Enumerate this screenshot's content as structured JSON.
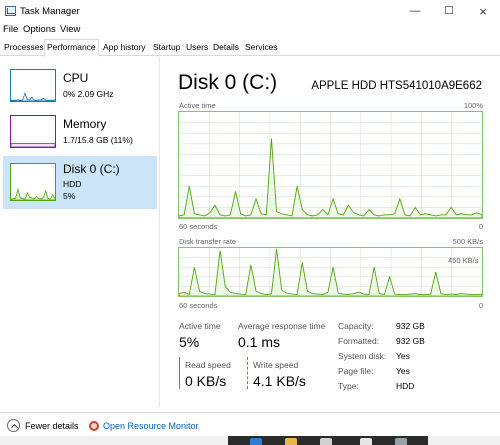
{
  "window": {
    "title": "Task Manager",
    "minimize_icon": "minimize-icon",
    "maximize_icon": "maximize-icon",
    "close_icon": "close-icon"
  },
  "menu": {
    "file": "File",
    "options": "Options",
    "view": "View"
  },
  "tabs": [
    {
      "label": "Processes",
      "active": false
    },
    {
      "label": "Performance",
      "active": true
    },
    {
      "label": "App history",
      "active": false
    },
    {
      "label": "Startup",
      "active": false
    },
    {
      "label": "Users",
      "active": false
    },
    {
      "label": "Details",
      "active": false
    },
    {
      "label": "Services",
      "active": false
    }
  ],
  "sidebar": {
    "items": [
      {
        "name": "CPU",
        "line1": "0%  2.09 GHz",
        "line2": "",
        "color": "#117dbb",
        "selected": false,
        "usage": [
          2,
          3,
          2,
          4,
          2,
          3,
          25,
          5,
          3,
          12,
          3,
          2,
          4,
          3,
          9,
          3,
          2,
          3,
          2,
          4
        ]
      },
      {
        "name": "Memory",
        "line1": "1.7/15.8 GB (11%)",
        "line2": "",
        "color": "#8b12ae",
        "selected": false,
        "usage": [
          11,
          11,
          11,
          11,
          11,
          11,
          11,
          11,
          11,
          11,
          11,
          11,
          11,
          11,
          11,
          11,
          11,
          11,
          11,
          11
        ]
      },
      {
        "name": "Disk 0 (C:)",
        "line1": "HDD",
        "line2": "5%",
        "color": "#4da60c",
        "selected": true,
        "usage": [
          2,
          4,
          5,
          30,
          6,
          4,
          2,
          20,
          8,
          5,
          3,
          10,
          4,
          3,
          6,
          25,
          4,
          3,
          15,
          5
        ]
      }
    ]
  },
  "main": {
    "title": "Disk 0 (C:)",
    "model": "APPLE HDD HTS541010A9E662",
    "active_time": {
      "label": "Active time",
      "max": "100%",
      "xlabel": "60 seconds",
      "xmin": "0",
      "values": [
        2,
        3,
        30,
        4,
        3,
        2,
        5,
        12,
        3,
        2,
        3,
        25,
        4,
        2,
        3,
        18,
        4,
        3,
        75,
        6,
        4,
        3,
        2,
        30,
        8,
        3,
        2,
        3,
        8,
        3,
        18,
        4,
        3,
        12,
        5,
        3,
        2,
        8,
        3,
        2,
        3,
        3,
        4,
        18,
        3,
        2,
        10,
        3,
        4,
        3,
        2,
        3,
        3,
        10,
        3,
        4,
        3,
        3,
        5,
        3
      ]
    },
    "transfer_rate": {
      "label": "Disk transfer rate",
      "max": "500 KB/s",
      "secondary": "450 KB/s",
      "xlabel": "60 seconds",
      "xmin": "0",
      "values": [
        5,
        8,
        3,
        60,
        10,
        5,
        4,
        3,
        95,
        20,
        8,
        5,
        4,
        3,
        65,
        10,
        5,
        3,
        4,
        98,
        12,
        6,
        4,
        3,
        70,
        10,
        5,
        4,
        3,
        8,
        60,
        6,
        4,
        3,
        5,
        8,
        4,
        3,
        60,
        5,
        3,
        40,
        4,
        3,
        3,
        4,
        5,
        3,
        3,
        4,
        50,
        5,
        3,
        4,
        3,
        5,
        4,
        3,
        3,
        4
      ]
    },
    "stats": {
      "active_time_label": "Active time",
      "active_time_value": "5%",
      "avg_response_label": "Average response time",
      "avg_response_value": "0.1 ms",
      "read_speed_label": "Read speed",
      "read_speed_value": "0 KB/s",
      "write_speed_label": "Write speed",
      "write_speed_value": "4.1 KB/s"
    },
    "properties": [
      {
        "key": "Capacity:",
        "value": "932 GB"
      },
      {
        "key": "Formatted:",
        "value": "932 GB"
      },
      {
        "key": "System disk:",
        "value": "Yes"
      },
      {
        "key": "Page file:",
        "value": "Yes"
      },
      {
        "key": "Type:",
        "value": "HDD"
      }
    ]
  },
  "footer": {
    "fewer_details": "Fewer details",
    "open_resource_monitor": "Open Resource Monitor"
  },
  "colors": {
    "disk_line": "#4da60c",
    "disk_fill": "#eef7e6",
    "grid": "#cfe6c3",
    "selection": "#cce4f7"
  }
}
